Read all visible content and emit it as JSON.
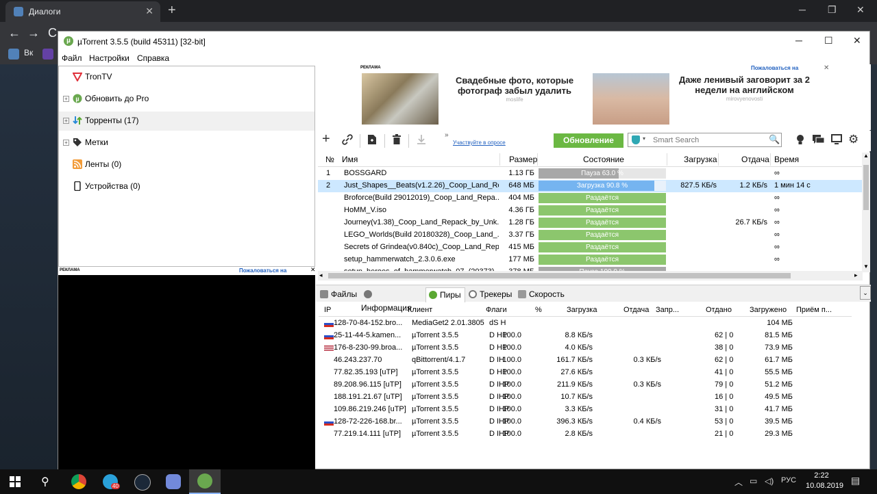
{
  "browser": {
    "tab_title": "Диалоги",
    "bookmarks": [
      "Вк"
    ]
  },
  "window": {
    "title": "µTorrent 3.5.5  (build 45311) [32-bit]",
    "menu": [
      "Файл",
      "Настройки",
      "Справка"
    ]
  },
  "sidebar": {
    "items": [
      {
        "label": "TronTV",
        "icon": "trontv-icon"
      },
      {
        "label": "Обновить до Pro",
        "icon": "utorrent-pro-icon"
      },
      {
        "label": "Торренты (17)",
        "icon": "torrents-icon"
      },
      {
        "label": "Метки",
        "icon": "label-tag-icon"
      },
      {
        "label": "Ленты (0)",
        "icon": "rss-feed-icon"
      },
      {
        "label": "Устройства (0)",
        "icon": "device-phone-icon"
      }
    ]
  },
  "ads": {
    "left_tag": "РЕКЛАМА",
    "left_report": "Пожаловаться на",
    "top_tag": "РЕКЛАМА",
    "top_report": "Пожаловаться на",
    "ad1_headline": "Свадебные фото, которые фотограф забыл удалить",
    "ad1_source": "moslife",
    "ad2_headline": "Даже ленивый заговорит за 2 недели на английском",
    "ad2_source": "mirovyenovosti"
  },
  "toolbar": {
    "survey_link": "Участвуйте в опросе",
    "update_button": "Обновление",
    "search_placeholder": "Smart Search",
    "more": "»"
  },
  "torrents": {
    "columns": [
      "№",
      "Имя",
      "Размер",
      "Состояние",
      "Загрузка",
      "Отдача",
      "Время"
    ],
    "rows": [
      {
        "num": "1",
        "name": "BOSSGARD",
        "size": "1.13 ГБ",
        "status": "Пауза 63.0 %",
        "progress": 0.63,
        "state": "paused",
        "down": "",
        "up": "",
        "eta": "∞"
      },
      {
        "num": "2",
        "name": "Just_Shapes__Beats(v1.2.26)_Coop_Land_Re...",
        "size": "648 МБ",
        "status": "Загрузка 90.8 %",
        "progress": 0.908,
        "state": "downloading",
        "down": "827.5 КБ/s",
        "up": "1.2 КБ/s",
        "eta": "1 мин 14 с"
      },
      {
        "num": "",
        "name": "Broforce(Build 29012019)_Coop_Land_Repa...",
        "size": "404 МБ",
        "status": "Раздаётся",
        "progress": 1,
        "state": "seeding",
        "down": "",
        "up": "",
        "eta": "∞"
      },
      {
        "num": "",
        "name": "HoMM_V.iso",
        "size": "4.36 ГБ",
        "status": "Раздаётся",
        "progress": 1,
        "state": "seeding",
        "down": "",
        "up": "",
        "eta": "∞"
      },
      {
        "num": "",
        "name": "Journey(v1.38)_Coop_Land_Repack_by_Unk...",
        "size": "1.28 ГБ",
        "status": "Раздаётся",
        "progress": 1,
        "state": "seeding",
        "down": "",
        "up": "26.7 КБ/s",
        "eta": "∞"
      },
      {
        "num": "",
        "name": "LEGO_Worlds(Build 20180328)_Coop_Land_...",
        "size": "3.37 ГБ",
        "status": "Раздаётся",
        "progress": 1,
        "state": "seeding",
        "down": "",
        "up": "",
        "eta": "∞"
      },
      {
        "num": "",
        "name": "Secrets of Grindea(v0.840c)_Coop_Land_Rep...",
        "size": "415 МБ",
        "status": "Раздаётся",
        "progress": 1,
        "state": "seeding",
        "down": "",
        "up": "",
        "eta": "∞"
      },
      {
        "num": "",
        "name": "setup_hammerwatch_2.3.0.6.exe",
        "size": "177 МБ",
        "status": "Раздаётся",
        "progress": 1,
        "state": "seeding",
        "down": "",
        "up": "",
        "eta": "∞"
      },
      {
        "num": "",
        "name": "setup_heroes_of_hammerwatch_07_(20373)...",
        "size": "378 МБ",
        "status": "Пауза 100.0 %",
        "progress": 1,
        "state": "paused",
        "down": "",
        "up": "",
        "eta": ""
      }
    ]
  },
  "detail_tabs": [
    {
      "label": "Файлы",
      "icon": "files-icon"
    },
    {
      "label": "Информация",
      "icon": "info-icon"
    },
    {
      "label": "Пиры",
      "icon": "peers-icon"
    },
    {
      "label": "Трекеры",
      "icon": "trackers-icon"
    },
    {
      "label": "Скорость",
      "icon": "speed-icon"
    }
  ],
  "peers": {
    "columns": [
      "IP",
      "Клиент",
      "Флаги",
      "%",
      "Загрузка",
      "Отдача",
      "Запр...",
      "Отдано",
      "Загружено",
      "Приём п..."
    ],
    "rows": [
      {
        "flag": "ru",
        "ip": "128-70-84-152.bro...",
        "client": "MediaGet2 2.01.3805",
        "flags": "dS H",
        "pct": "",
        "down": "",
        "up": "",
        "req": "",
        "sent": "",
        "recv": "104 МБ"
      },
      {
        "flag": "ru",
        "ip": "25-11-44-5.kamen...",
        "client": "µTorrent 3.5.5",
        "flags": "D HP",
        "pct": "100.0",
        "down": "8.8 КБ/s",
        "up": "",
        "req": "62 | 0",
        "sent": "",
        "recv": "81.5 МБ"
      },
      {
        "flag": "us",
        "ip": "176-8-230-99.broa...",
        "client": "µTorrent 3.5.5",
        "flags": "D HP",
        "pct": "100.0",
        "down": "4.0 КБ/s",
        "up": "",
        "req": "38 | 0",
        "sent": "",
        "recv": "73.9 МБ"
      },
      {
        "flag": "",
        "ip": "46.243.237.70",
        "client": "qBittorrent/4.1.7",
        "flags": "D IH",
        "pct": "100.0",
        "down": "161.7 КБ/s",
        "up": "0.3 КБ/s",
        "req": "62 | 0",
        "sent": "",
        "recv": "61.7 МБ"
      },
      {
        "flag": "",
        "ip": "77.82.35.193 [uTP]",
        "client": "µTorrent 3.5.5",
        "flags": "D HP",
        "pct": "100.0",
        "down": "27.6 КБ/s",
        "up": "",
        "req": "41 | 0",
        "sent": "",
        "recv": "55.5 МБ"
      },
      {
        "flag": "",
        "ip": "89.208.96.115 [uTP]",
        "client": "µTorrent 3.5.5",
        "flags": "D IHP",
        "pct": "100.0",
        "down": "211.9 КБ/s",
        "up": "0.3 КБ/s",
        "req": "79 | 0",
        "sent": "",
        "recv": "51.2 МБ"
      },
      {
        "flag": "",
        "ip": "188.191.21.67 [uTP]",
        "client": "µTorrent 3.5.5",
        "flags": "D IHP",
        "pct": "100.0",
        "down": "10.7 КБ/s",
        "up": "",
        "req": "16 | 0",
        "sent": "",
        "recv": "49.5 МБ"
      },
      {
        "flag": "",
        "ip": "109.86.219.246 [uTP]",
        "client": "µTorrent 3.5.5",
        "flags": "D IHP",
        "pct": "100.0",
        "down": "3.3 КБ/s",
        "up": "",
        "req": "31 | 0",
        "sent": "",
        "recv": "41.7 МБ"
      },
      {
        "flag": "ru",
        "ip": "128-72-226-168.br...",
        "client": "µTorrent 3.5.5",
        "flags": "D IHP",
        "pct": "100.0",
        "down": "396.3 КБ/s",
        "up": "0.4 КБ/s",
        "req": "53 | 0",
        "sent": "",
        "recv": "39.5 МБ"
      },
      {
        "flag": "",
        "ip": "77.219.14.111 [uTP]",
        "client": "µTorrent 3.5.5",
        "flags": "D IHP",
        "pct": "100.0",
        "down": "2.8 КБ/s",
        "up": "",
        "req": "21 | 0",
        "sent": "",
        "recv": "29.3 МБ"
      }
    ]
  },
  "taskbar": {
    "apps": [
      "chrome-icon",
      "telegram-icon",
      "steam-icon",
      "discord-icon",
      "utorrent-icon"
    ],
    "telegram_badge": "40",
    "lang": "РУС",
    "time": "2:22",
    "date": "10.08.2019"
  },
  "colors": {
    "seeding": "#8cc66d",
    "downloading": "#75b4f0",
    "paused": "#a8a8a8",
    "update_button": "#6bb843",
    "selection": "#cde8ff"
  }
}
